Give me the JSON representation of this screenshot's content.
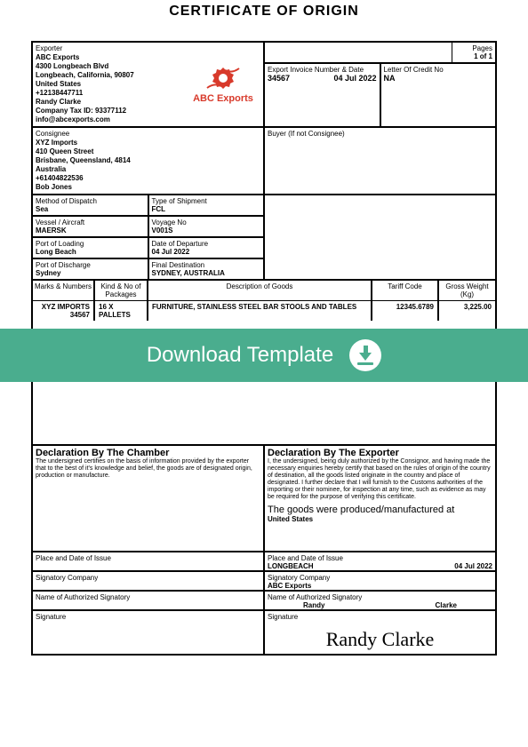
{
  "title": "CERTIFICATE OF ORIGIN",
  "pages": {
    "label": "Pages",
    "value": "1 of 1"
  },
  "exporter": {
    "label": "Exporter",
    "company": "ABC Exports",
    "address1": "4300 Longbeach Blvd",
    "address2": "Longbeach, California, 90807",
    "country": "United States",
    "phone": "+12138447711",
    "contact": "Randy Clarke",
    "tax": "Company Tax ID: 93377112",
    "email": "info@abcexports.com",
    "brand": "ABC Exports"
  },
  "invoice": {
    "label": "Export Invoice Number & Date",
    "number": "34567",
    "date": "04 Jul 2022"
  },
  "credit": {
    "label": "Letter Of Credit No",
    "value": "NA"
  },
  "consignee": {
    "label": "Consignee",
    "company": "XYZ Imports",
    "address1": "410 Queen Street",
    "address2": "Brisbane, Queensland, 4814",
    "country": "Australia",
    "phone": "+61404822536",
    "contact": "Bob Jones"
  },
  "buyer": {
    "label": "Buyer (If not Consignee)"
  },
  "ship": {
    "dispatch": {
      "label": "Method of Dispatch",
      "value": "Sea"
    },
    "shipment": {
      "label": "Type of Shipment",
      "value": "FCL"
    },
    "vessel": {
      "label": "Vessel / Aircraft",
      "value": "MAERSK"
    },
    "voyage": {
      "label": "Voyage No",
      "value": "V001S"
    },
    "loading": {
      "label": "Port of Loading",
      "value": "Long Beach"
    },
    "departure": {
      "label": "Date of Departure",
      "value": "04 Jul 2022"
    },
    "discharge": {
      "label": "Port of Discharge",
      "value": "Sydney"
    },
    "destination": {
      "label": "Final Destination",
      "value": "SYDNEY, AUSTRALIA"
    }
  },
  "goods": {
    "headers": {
      "marks": "Marks & Numbers",
      "kind": "Kind & No of Packages",
      "desc": "Description of Goods",
      "tariff": "Tariff Code",
      "weight": "Gross Weight (Kg)"
    },
    "row": {
      "marks": "XYZ IMPORTS 34567",
      "kind": "16 X PALLETS",
      "desc": "FURNITURE, STAINLESS STEEL BAR STOOLS AND TABLES",
      "tariff": "12345.6789",
      "weight": "3,225.00"
    }
  },
  "banner": {
    "text": "Download Template"
  },
  "chamber": {
    "title": "Declaration By The Chamber",
    "body": "The undersigned certifies on the basis of information provided by the exporter that to the best of it's knowledge and belief, the goods are of designated origin, production or manufacture.",
    "placeDate": "Place and Date of Issue",
    "sigCompany": "Signatory Company",
    "nameAuth": "Name of Authorized Signatory",
    "signature": "Signature"
  },
  "exporterDecl": {
    "title": "Declaration By The Exporter",
    "body": "I, the undersigned, being duly authorized by the Consignor, and having made the necessary enquiries hereby certify that based on the rules of origin of the country of destination, all the goods listed originate in the country and place of designated. I further declare that I will furnish to the Customs authorities of the importing or their nominee, for inspection at any time, such as evidence as may be required for the purpose of verifying this certificate.",
    "produced": "The goods were produced/manufactured at",
    "producedVal": "United States",
    "placeDateLabel": "Place and Date of Issue",
    "placeVal": "LONGBEACH",
    "dateVal": "04 Jul 2022",
    "sigCompanyLabel": "Signatory Company",
    "sigCompanyVal": "ABC Exports",
    "nameAuthLabel": "Name of Authorized Signatory",
    "firstName": "Randy",
    "lastName": "Clarke",
    "signatureLabel": "Signature",
    "signatureVal": "Randy Clarke"
  }
}
